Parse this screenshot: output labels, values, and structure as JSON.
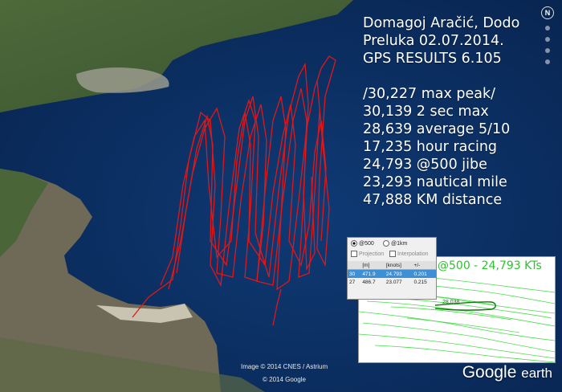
{
  "stats": {
    "line1": "Domagoj Aračić, Dodo",
    "line2": "Preluka 02.07.2014.",
    "line3": "GPS RESULTS 6.105",
    "line4": "/30,227 max peak/",
    "line5": "30,139 2 sec max",
    "line6": "28,639 average 5/10",
    "line7": "17,235 hour racing",
    "line8": "24,793 @500 jibe",
    "line9": "23,293 nautical mile",
    "line10": "47,888 KM distance"
  },
  "nav": {
    "north_label": "N"
  },
  "gps_panel": {
    "radio_500": "@500",
    "radio_1km": "@1km",
    "check_projection": "Projection",
    "check_interpolation": "Interpolation",
    "col_m": "[m]",
    "col_knots": "[knots]",
    "col_pm": "+/-",
    "rows": [
      {
        "idx": "30",
        "m": "471.9",
        "knots": "24.793",
        "pm": "0.201"
      },
      {
        "idx": "27",
        "m": "486.7",
        "knots": "23.077",
        "pm": "0.215"
      }
    ]
  },
  "inset": {
    "title": "@500 - 24,793 KTs",
    "marker_label": "28.038"
  },
  "credits": {
    "imagery": "Image © 2014 CNES / Astrium",
    "copyright": "© 2014 Google"
  },
  "logo": {
    "google": "Google",
    "earth": "earth"
  },
  "colors": {
    "track": "#e01818",
    "inset_tracks": "#39d639",
    "water": "#0b2f63"
  }
}
